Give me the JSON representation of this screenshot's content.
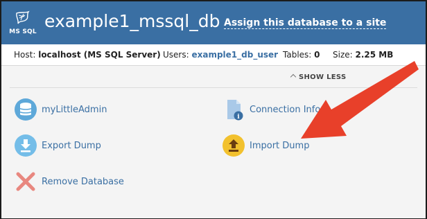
{
  "header": {
    "badge": "MS SQL",
    "title": "example1_mssql_db",
    "assign_link": "Assign this database to a site"
  },
  "info": {
    "host_label": "Host:",
    "host_value": "localhost (MS SQL Server)",
    "users_label": "Users:",
    "users_value": "example1_db_user",
    "tables_label": "Tables:",
    "tables_value": "0",
    "size_label": "Size:",
    "size_value": "2.25 MB"
  },
  "tools": {
    "show_less": "SHOW LESS",
    "actions": [
      {
        "label": "myLittleAdmin",
        "icon": "database-icon"
      },
      {
        "label": "Connection Info",
        "icon": "document-info-icon"
      },
      {
        "label": "Export Dump",
        "icon": "download-icon"
      },
      {
        "label": "Import Dump",
        "icon": "upload-icon"
      },
      {
        "label": "Remove Database",
        "icon": "remove-x-icon"
      }
    ]
  },
  "colors": {
    "header_bg": "#3a6fa3",
    "link": "#3a6fa3",
    "arrow": "#e8402a",
    "import_icon": "#f2c12e",
    "export_icon": "#74bde8",
    "remove_icon": "#e8877f"
  }
}
